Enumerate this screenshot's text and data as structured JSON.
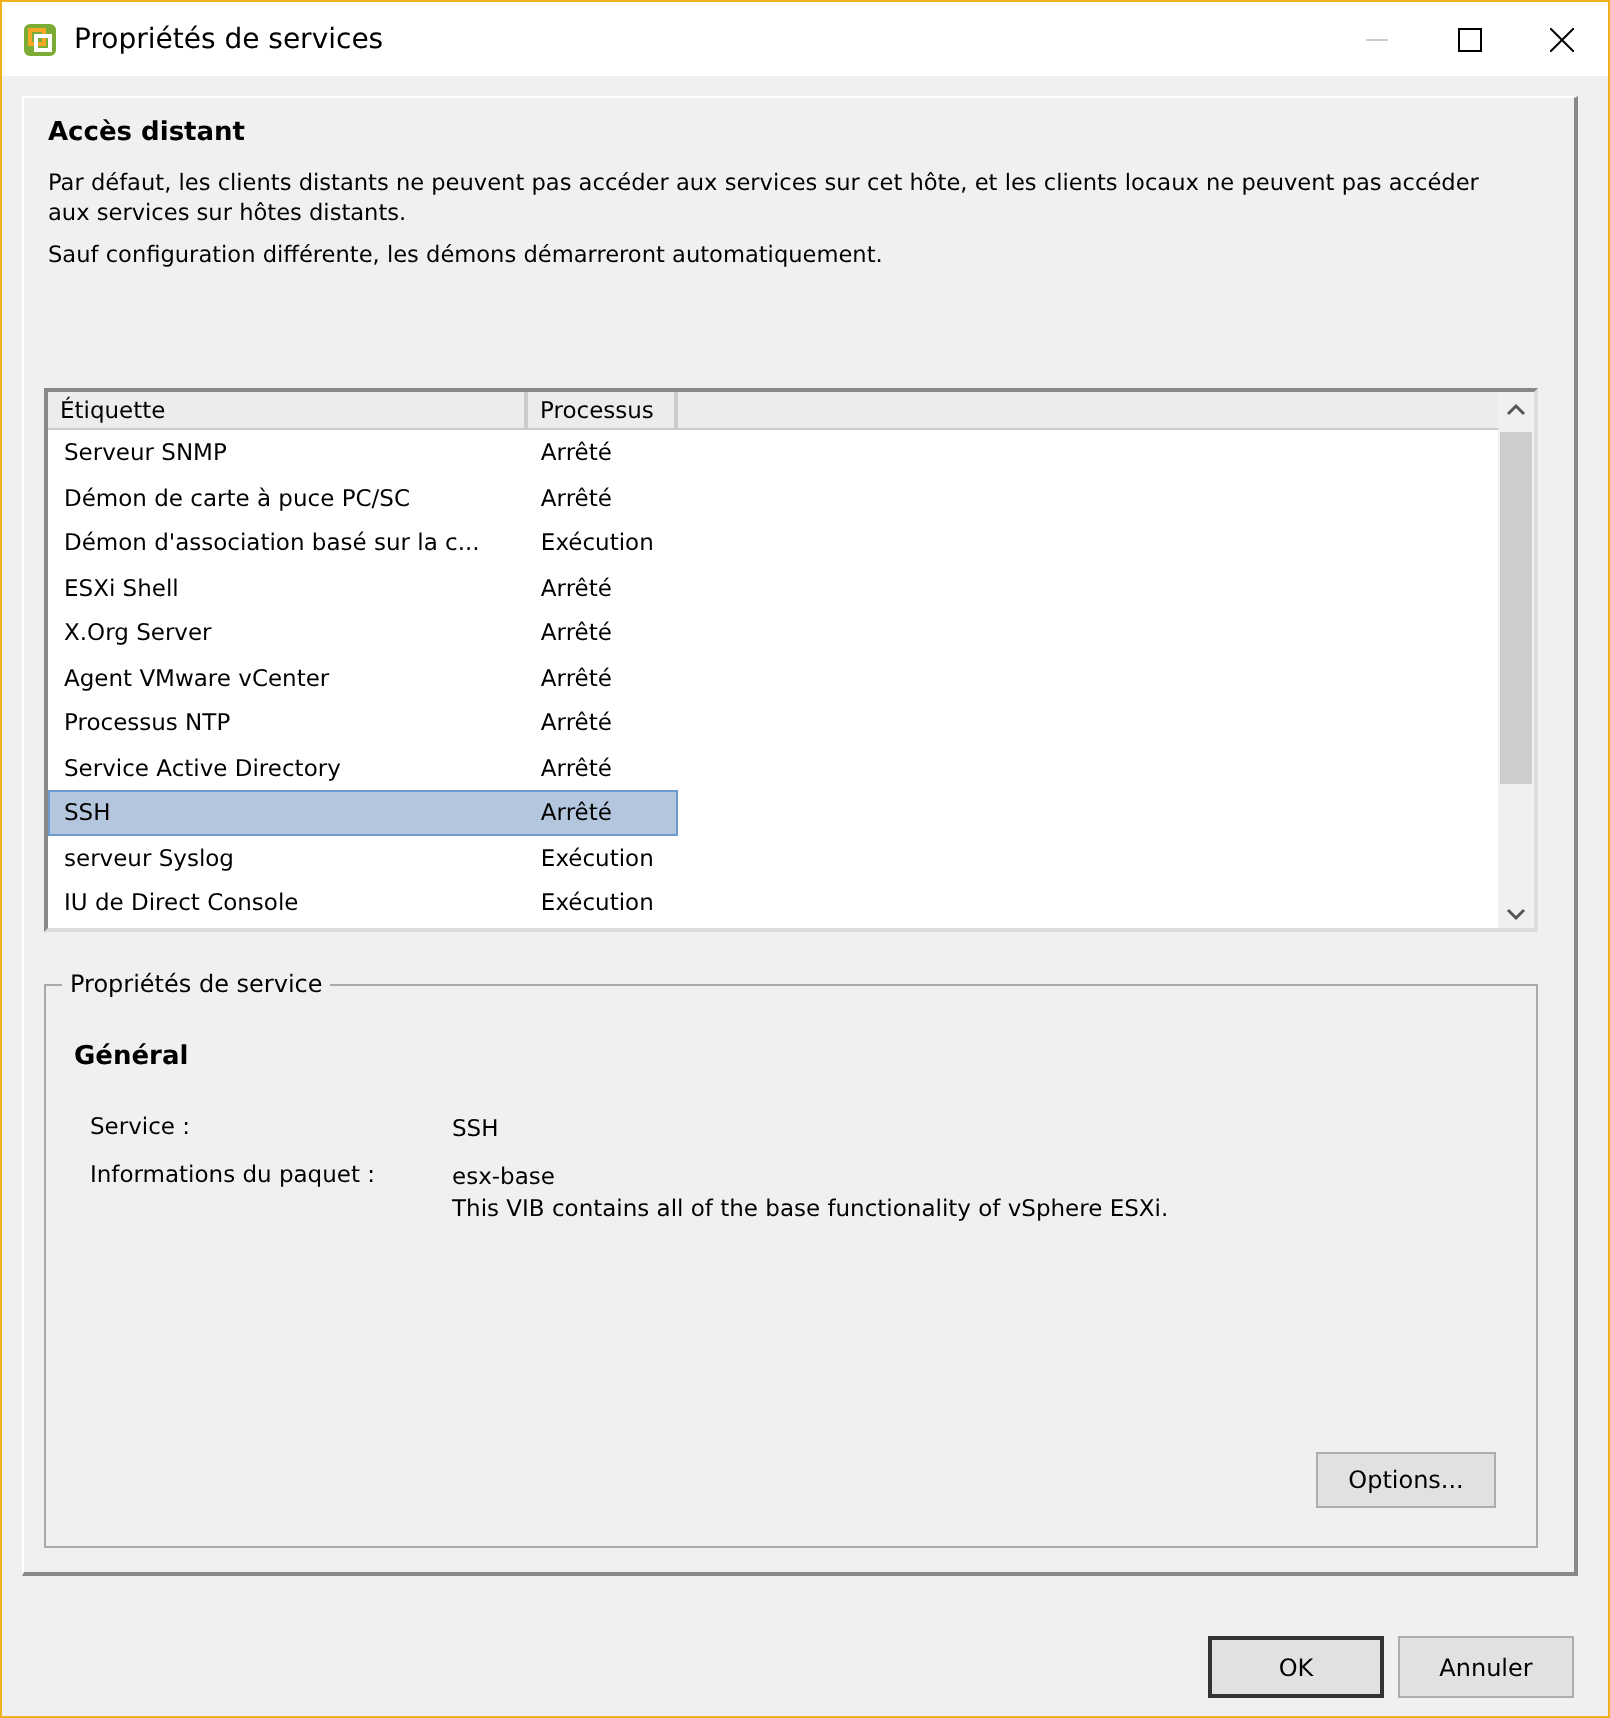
{
  "window": {
    "title": "Propriétés de services"
  },
  "header": {
    "title": "Accès distant",
    "paragraphs": [
      "Par défaut, les clients distants ne peuvent pas accéder aux services sur cet hôte, et les clients locaux ne peuvent pas accéder aux services sur hôtes distants.",
      "Sauf configuration différente, les démons démarreront automatiquement."
    ]
  },
  "table": {
    "columns": [
      "Étiquette",
      "Processus"
    ],
    "rows": [
      {
        "label": "Serveur SNMP",
        "process": "Arrêté",
        "selected": false
      },
      {
        "label": "Démon de carte à puce PC/SC",
        "process": "Arrêté",
        "selected": false
      },
      {
        "label": "Démon d'association basé sur la c...",
        "process": "Exécution",
        "selected": false
      },
      {
        "label": "ESXi Shell",
        "process": "Arrêté",
        "selected": false
      },
      {
        "label": "X.Org Server",
        "process": "Arrêté",
        "selected": false
      },
      {
        "label": "Agent VMware vCenter",
        "process": "Arrêté",
        "selected": false
      },
      {
        "label": "Processus NTP",
        "process": "Arrêté",
        "selected": false
      },
      {
        "label": "Service Active Directory",
        "process": "Arrêté",
        "selected": false
      },
      {
        "label": "SSH",
        "process": "Arrêté",
        "selected": true
      },
      {
        "label": "serveur Syslog",
        "process": "Exécution",
        "selected": false
      },
      {
        "label": "IU de Direct Console",
        "process": "Exécution",
        "selected": false
      }
    ]
  },
  "properties": {
    "legend": "Propriétés de service",
    "section": "Général",
    "fields": [
      {
        "label": "Service :",
        "lines": [
          "SSH"
        ]
      },
      {
        "label": "Informations du paquet :",
        "lines": [
          "esx-base",
          "This VIB contains all of the base functionality of vSphere ESXi."
        ]
      }
    ],
    "button": "Options..."
  },
  "buttons": [
    {
      "label": "OK",
      "default": true
    },
    {
      "label": "Annuler",
      "default": false
    }
  ]
}
